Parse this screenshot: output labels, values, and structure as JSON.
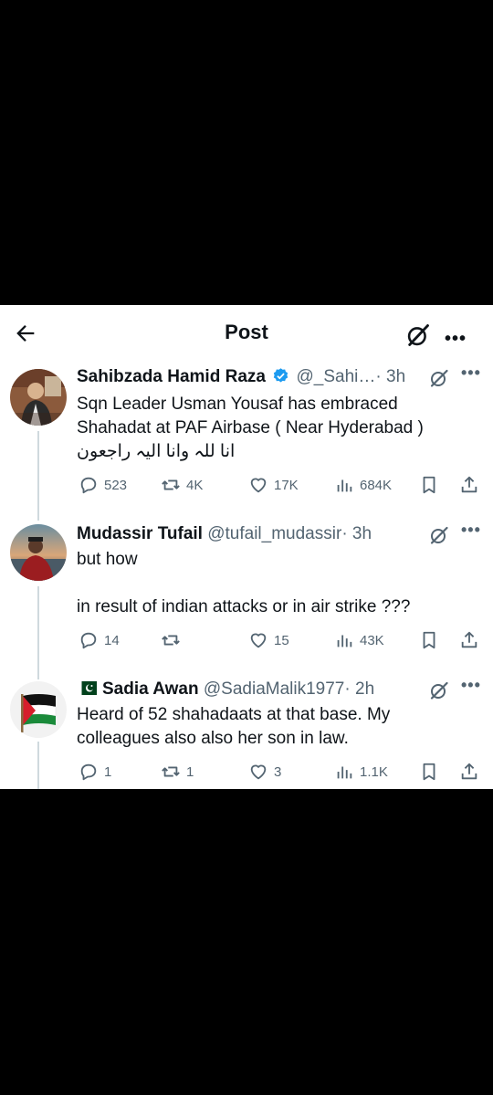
{
  "header": {
    "title": "Post",
    "back_icon": "arrow-left-icon",
    "grok_icon": "grok-icon",
    "more": "•••"
  },
  "tweets": [
    {
      "name": "Sahibzada Hamid Raza",
      "verified": true,
      "handle": "@_Sahi…",
      "time": "· 3h",
      "text": [
        "Sqn Leader Usman Yousaf has embraced",
        "Shahadat at PAF Airbase ( Near Hyderabad )",
        "انا للہ وانا الیہ راجعون"
      ],
      "replies": "523",
      "reposts": "4K",
      "likes": "17K",
      "views": "684K"
    },
    {
      "name": "Mudassir Tufail",
      "verified": false,
      "handle": "@tufail_mudassir",
      "time": "· 3h",
      "text": [
        "but how",
        "",
        "in result of indian attacks or in air strike ???"
      ],
      "replies": "14",
      "reposts": "",
      "likes": "15",
      "views": "43K"
    },
    {
      "name": "Sadia Awan",
      "flag": "🇵🇰",
      "verified": false,
      "handle": "@SadiaMalik1977",
      "time": "· 2h",
      "text": [
        "Heard of 52 shahadaats at that base. My",
        "colleagues also also her son in law."
      ],
      "replies": "1",
      "reposts": "1",
      "likes": "3",
      "views": "1.1K"
    }
  ],
  "more_label": "•••",
  "colors": {
    "verified": "#1d9bf0",
    "secondary": "#536471",
    "line": "#cfd9de"
  }
}
